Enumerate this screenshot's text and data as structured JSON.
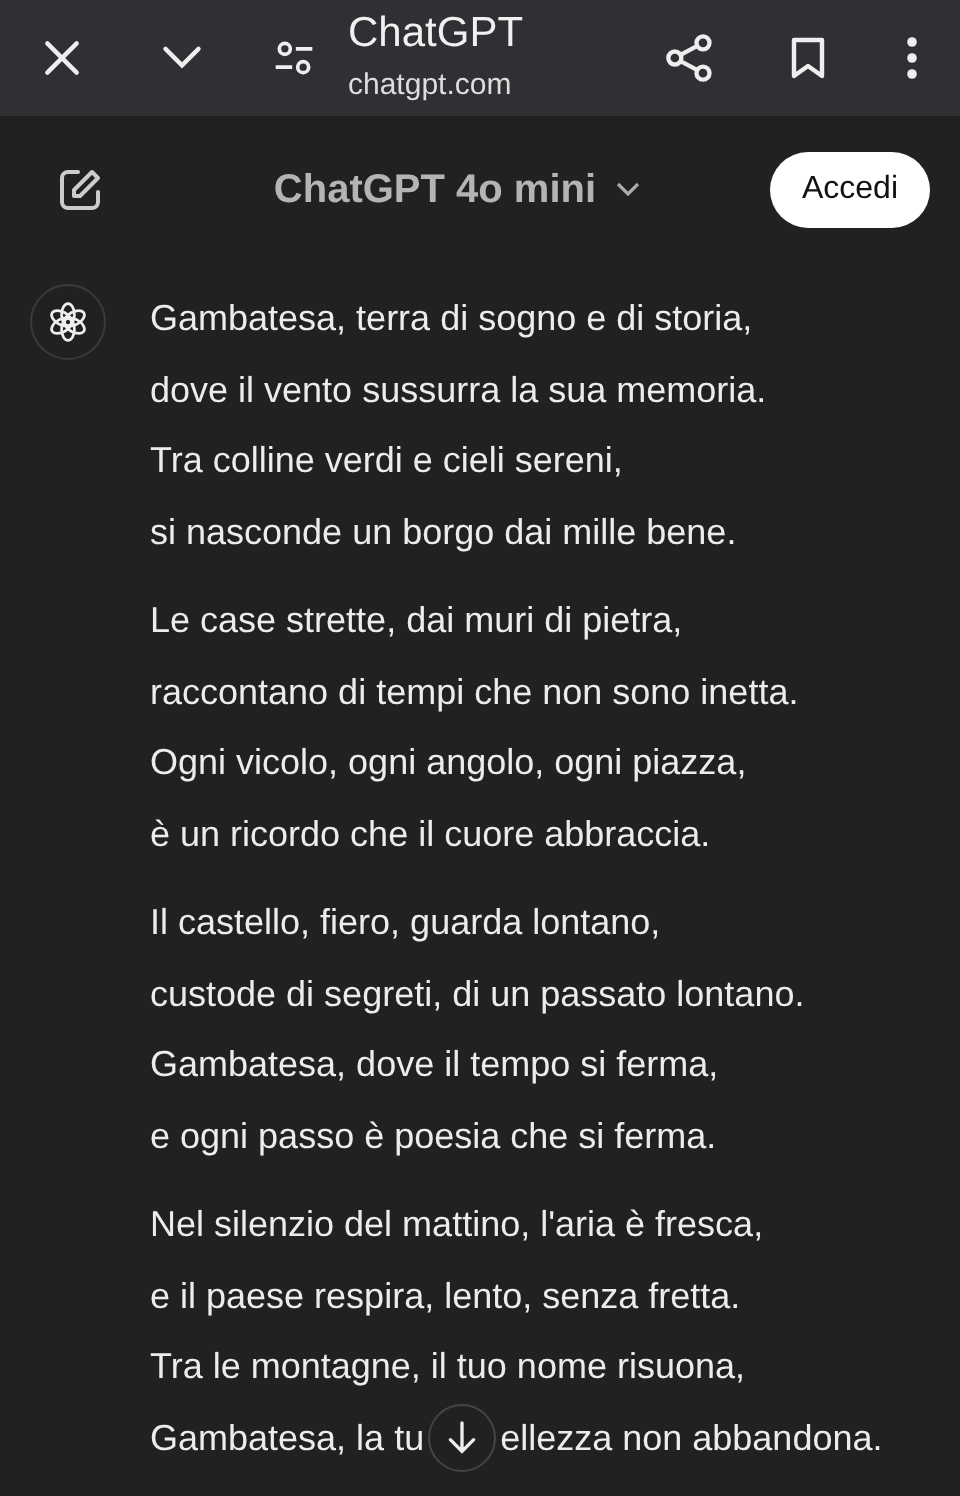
{
  "browser_bar": {
    "title": "ChatGPT",
    "url": "chatgpt.com"
  },
  "header": {
    "model": "ChatGPT 4o mini",
    "login_button": "Accedi"
  },
  "message": {
    "stanzas": [
      {
        "lines": [
          "Gambatesa, terra di sogno e di storia,",
          "dove il vento sussurra la sua memoria.",
          "Tra colline verdi e cieli sereni,",
          "si nasconde un borgo dai mille bene."
        ]
      },
      {
        "lines": [
          "Le case strette, dai muri di pietra,",
          "raccontano di tempi che non sono inetta.",
          "Ogni vicolo, ogni angolo, ogni piazza,",
          "è un ricordo che il cuore abbraccia."
        ]
      },
      {
        "lines": [
          "Il castello, fiero, guarda lontano,",
          "custode di segreti, di un passato lontano.",
          "Gambatesa, dove il tempo si ferma,",
          "e ogni passo è poesia che si ferma."
        ]
      },
      {
        "lines": [
          "Nel silenzio del mattino, l'aria è fresca,",
          "e il paese respira, lento, senza fretta.",
          "Tra le montagne, il tuo nome risuona,"
        ],
        "last_line_parts": [
          "Gambatesa, la tu",
          "ellezza non abbandona."
        ]
      }
    ]
  }
}
